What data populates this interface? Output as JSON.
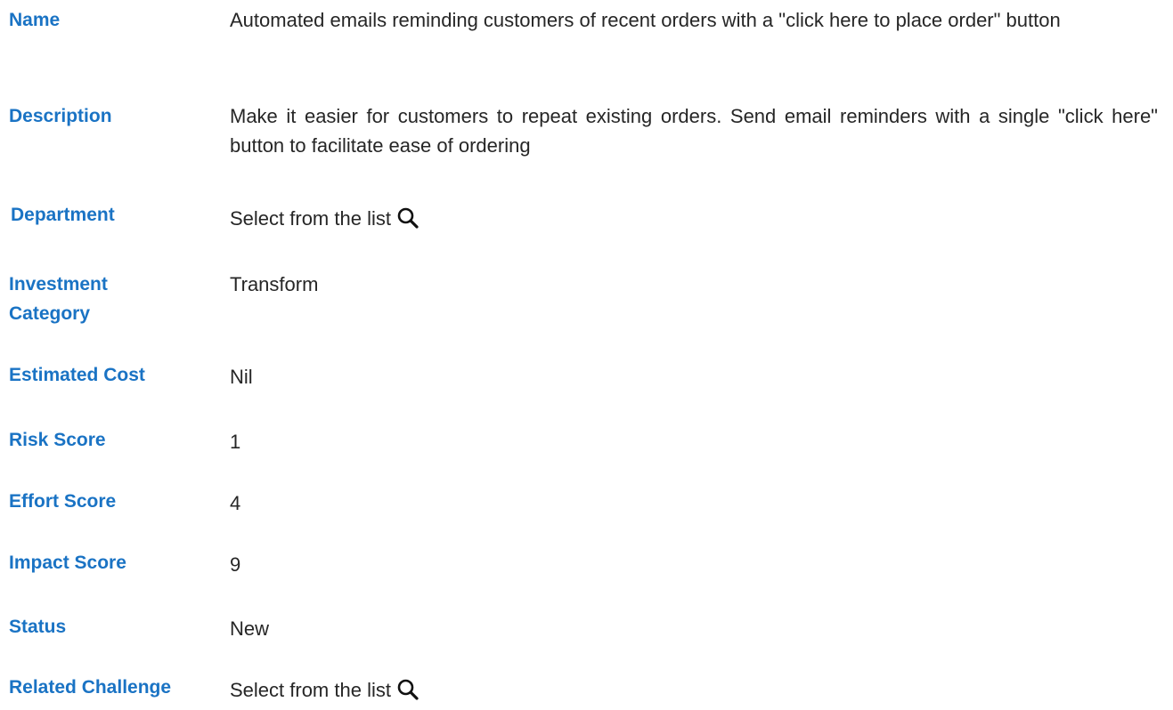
{
  "fields": {
    "name": {
      "label": "Name",
      "value": "Automated emails reminding customers of recent orders with a \"click here to place order\" button"
    },
    "description": {
      "label": "Description",
      "value": "Make it easier for customers to repeat existing orders.  Send email reminders with a single \"click here\" button to facilitate ease of ordering"
    },
    "department": {
      "label": "Department",
      "value": "Select from the list",
      "icon": "search-icon"
    },
    "investment_category": {
      "label": "Investment Category",
      "value": "Transform"
    },
    "estimated_cost": {
      "label": "Estimated Cost",
      "value": "Nil"
    },
    "risk_score": {
      "label": "Risk Score",
      "value": "1"
    },
    "effort_score": {
      "label": "Effort Score",
      "value": "4"
    },
    "impact_score": {
      "label": "Impact Score",
      "value": "9"
    },
    "status": {
      "label": "Status",
      "value": "New"
    },
    "related_challenge": {
      "label": "Related Challenge",
      "value": "Select from the list",
      "icon": "search-icon"
    }
  },
  "colors": {
    "label": "#1a73c4",
    "value": "#262626",
    "background": "#ffffff"
  }
}
